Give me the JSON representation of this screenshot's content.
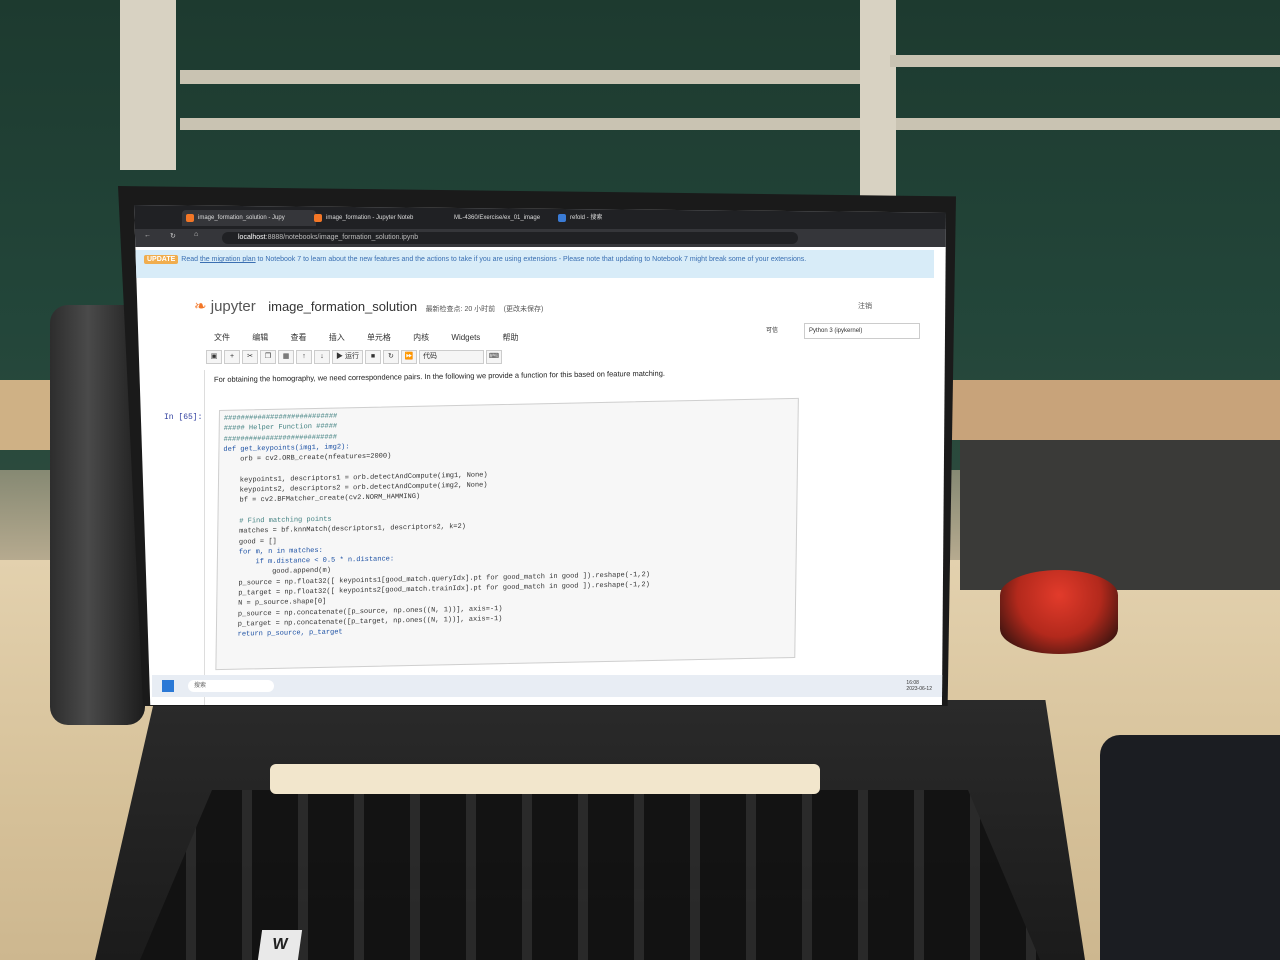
{
  "browser": {
    "tabs": [
      {
        "label": "image_formation_solution - Jupy"
      },
      {
        "label": "image_formation - Jupyter Noteb"
      },
      {
        "label": "ML-4360/Exercise/ex_01_image"
      },
      {
        "label": "refold - 搜索"
      }
    ],
    "address_host": "localhost",
    "address": ":8888/notebooks/image_formation_solution.ipynb"
  },
  "banner": {
    "badge": "UPDATE",
    "text_read": "Read ",
    "link": "the migration plan",
    "text_rest": " to Notebook 7 to learn about the new features and the actions to take if you are using extensions - Please note that updating to Notebook 7 might break some of your extensions."
  },
  "jupyter": {
    "logo": "jupyter",
    "notebook_name": "image_formation_solution",
    "checkpoint": "最新检查点: 20 小时前",
    "unsaved": "(更改未保存)",
    "logout": "注销",
    "trusted": "可信",
    "kernel": "Python 3 (ipykernel)",
    "menu": [
      "文件",
      "编辑",
      "查看",
      "插入",
      "单元格",
      "内核",
      "Widgets",
      "帮助"
    ],
    "run_label": "运行",
    "cell_type": "代码"
  },
  "markdown_text": "For obtaining the homography, we need correspondence pairs. In the following we provide a function for this based on feature matching.",
  "prompt": "In  [65]:",
  "code_lines": [
    "###########################",
    "##### Helper Function #####",
    "###########################",
    "def get_keypoints(img1, img2):",
    "    orb = cv2.ORB_create(nfeatures=2000)",
    "",
    "    keypoints1, descriptors1 = orb.detectAndCompute(img1, None)",
    "    keypoints2, descriptors2 = orb.detectAndCompute(img2, None)",
    "    bf = cv2.BFMatcher_create(cv2.NORM_HAMMING)",
    "",
    "    # Find matching points",
    "    matches = bf.knnMatch(descriptors1, descriptors2, k=2)",
    "    good = []",
    "    for m, n in matches:",
    "        if m.distance < 0.5 * n.distance:",
    "            good.append(m)",
    "    p_source = np.float32([ keypoints1[good_match.queryIdx].pt for good_match in good ]).reshape(-1,2)",
    "    p_target = np.float32([ keypoints2[good_match.trainIdx].pt for good_match in good ]).reshape(-1,2)",
    "    N = p_source.shape[0]",
    "    p_source = np.concatenate([p_source, np.ones((N, 1))], axis=-1)",
    "    p_target = np.concatenate([p_target, np.ones((N, 1))], axis=-1)",
    "    return p_source, p_target"
  ],
  "taskbar": {
    "search": "搜索",
    "time": "16:08",
    "date": "2023-06-12"
  },
  "keyboard": {
    "w_key": "W"
  }
}
